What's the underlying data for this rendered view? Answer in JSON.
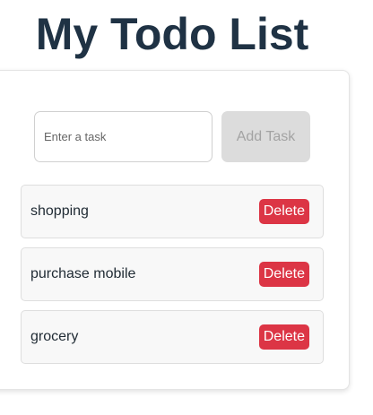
{
  "header": {
    "title": "My Todo List"
  },
  "form": {
    "input_placeholder": "Enter a task",
    "input_value": "",
    "add_label": "Add Task",
    "add_disabled": true
  },
  "tasks": [
    {
      "text": "shopping",
      "delete_label": "Delete"
    },
    {
      "text": "purchase mobile",
      "delete_label": "Delete"
    },
    {
      "text": "grocery",
      "delete_label": "Delete"
    }
  ],
  "colors": {
    "title": "#1f3244",
    "delete_button": "#dc3545",
    "add_button_disabled": "#dcdcdc"
  }
}
